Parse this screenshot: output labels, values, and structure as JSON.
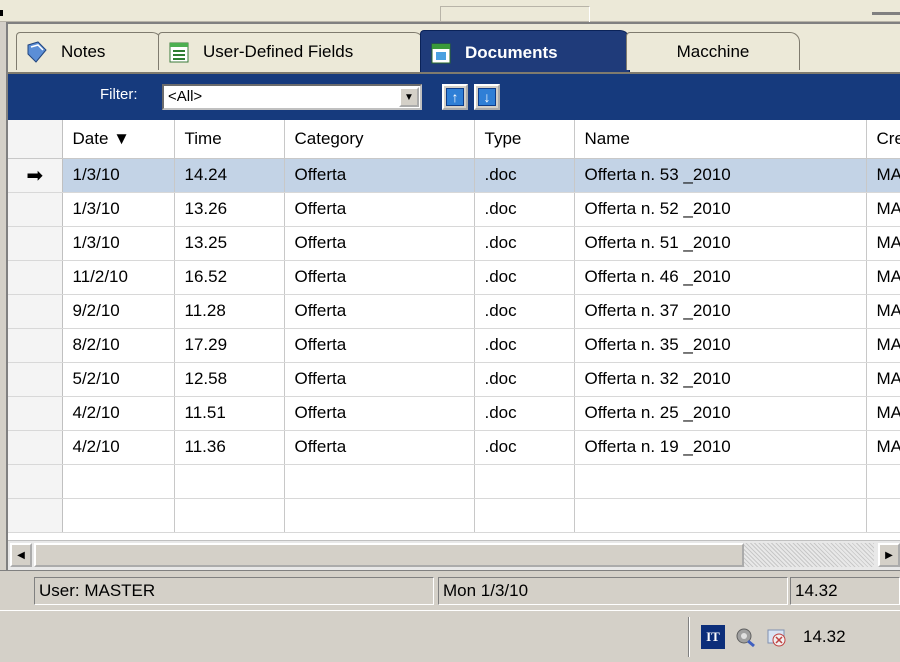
{
  "tabs": [
    {
      "label": "Notes",
      "icon": "notes-icon"
    },
    {
      "label": "User-Defined Fields",
      "icon": "fields-icon"
    },
    {
      "label": "Documents",
      "icon": "documents-icon",
      "active": true
    },
    {
      "label": "Macchine"
    }
  ],
  "filter": {
    "label": "Filter:",
    "value": "<All>"
  },
  "table": {
    "columns": [
      "Date ▼",
      "Time",
      "Category",
      "Type",
      "Name",
      "Cre"
    ],
    "rows": [
      {
        "date": "1/3/10",
        "time": "14.24",
        "category": "Offerta",
        "type": ".doc",
        "name": "Offerta n.  53 _2010",
        "cre": "MA",
        "selected": true
      },
      {
        "date": "1/3/10",
        "time": "13.26",
        "category": "Offerta",
        "type": ".doc",
        "name": "Offerta n.  52 _2010",
        "cre": "MA"
      },
      {
        "date": "1/3/10",
        "time": "13.25",
        "category": "Offerta",
        "type": ".doc",
        "name": "Offerta n.  51 _2010",
        "cre": "MA"
      },
      {
        "date": "11/2/10",
        "time": "16.52",
        "category": "Offerta",
        "type": ".doc",
        "name": "Offerta n.  46 _2010",
        "cre": "MA"
      },
      {
        "date": "9/2/10",
        "time": "11.28",
        "category": "Offerta",
        "type": ".doc",
        "name": "Offerta n.  37 _2010",
        "cre": "MA"
      },
      {
        "date": "8/2/10",
        "time": "17.29",
        "category": "Offerta",
        "type": ".doc",
        "name": "Offerta n.  35 _2010",
        "cre": "MA"
      },
      {
        "date": "5/2/10",
        "time": "12.58",
        "category": "Offerta",
        "type": ".doc",
        "name": "Offerta n.  32 _2010",
        "cre": "MA"
      },
      {
        "date": "4/2/10",
        "time": "11.51",
        "category": "Offerta",
        "type": ".doc",
        "name": "Offerta n.  25 _2010",
        "cre": "MA"
      },
      {
        "date": "4/2/10",
        "time": "11.36",
        "category": "Offerta",
        "type": ".doc",
        "name": "Offerta n.  19 _2010",
        "cre": "MA"
      }
    ]
  },
  "status": {
    "user": "User: MASTER",
    "date": "Mon  1/3/10",
    "time": "14.32"
  },
  "tray": {
    "lang": "IT",
    "time": "14.32"
  },
  "colors": {
    "filter_bar": "#163a7d",
    "active_tab": "#1f3b7a",
    "selected_row": "#c3d3e6"
  }
}
